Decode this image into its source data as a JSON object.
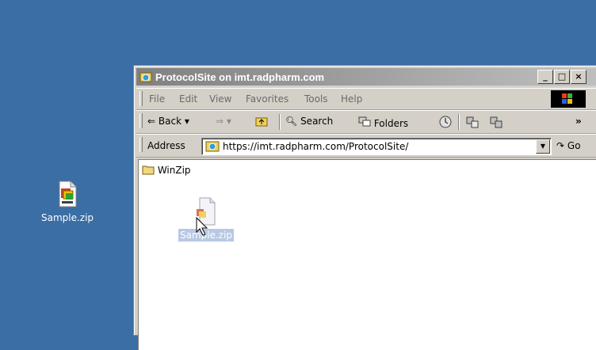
{
  "desktop": {
    "icon_label": "Sample.zip",
    "icon": "winzip-file-icon"
  },
  "window": {
    "title": "ProtocolSite on imt.radpharm.com",
    "controls": [
      "_",
      "□",
      "×"
    ],
    "menu": [
      "File",
      "Edit",
      "View",
      "Favorites",
      "Tools",
      "Help"
    ],
    "toolbar": {
      "back": "Back",
      "search": "Search",
      "folders": "Folders",
      "more": "»"
    },
    "address": {
      "label": "Address",
      "url": "https://imt.radpharm.com/ProtocolSite/",
      "go": "Go"
    },
    "content": {
      "folder_label": "WinZip",
      "file_label": "Sample.zip"
    }
  },
  "colors": {
    "desktop": "#3a6ea5",
    "titlebar_inactive": "#808080",
    "selection": "#b8c8e4"
  }
}
